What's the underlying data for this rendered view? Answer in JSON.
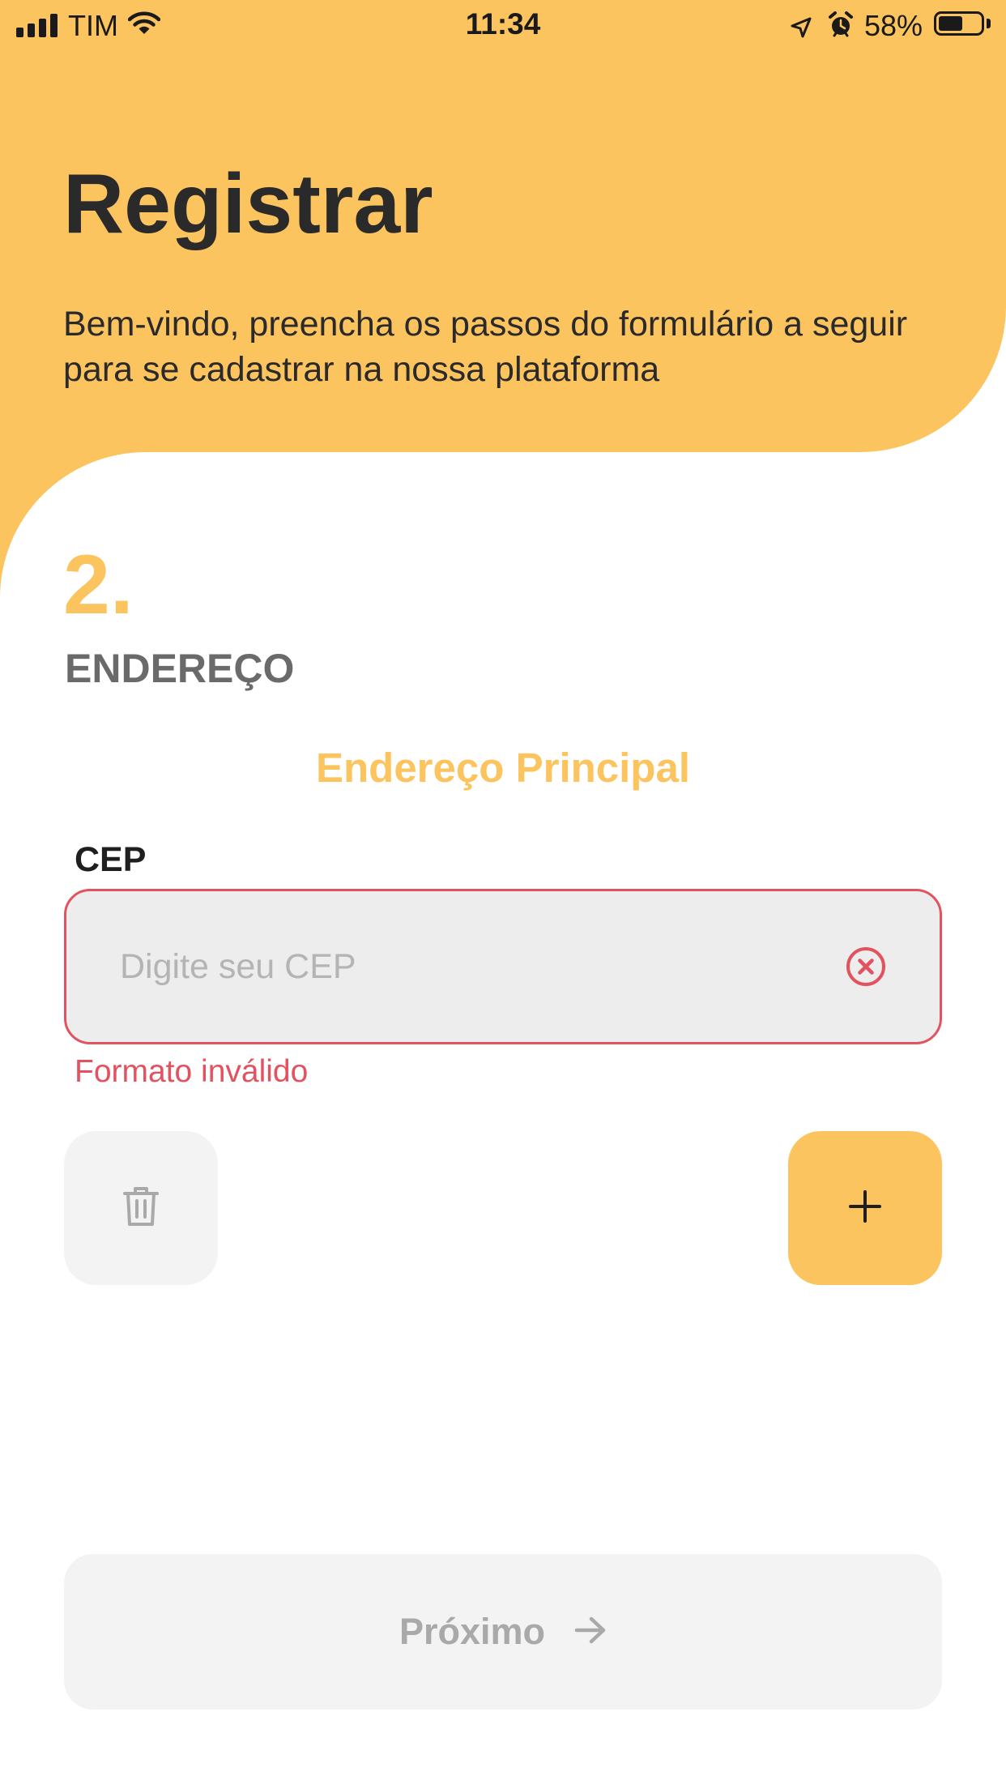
{
  "status_bar": {
    "carrier": "TIM",
    "time": "11:34",
    "battery_percent": "58%",
    "battery_level": 0.58,
    "icons": [
      "signal-icon",
      "wifi-icon",
      "location-icon",
      "alarm-icon",
      "battery-icon"
    ]
  },
  "header": {
    "title": "Registrar",
    "subtitle": "Bem-vindo, preencha os passos do formulário a seguir para se cadastrar na nossa plataforma"
  },
  "step": {
    "number": "2.",
    "title": "ENDEREÇO"
  },
  "section": {
    "title": "Endereço Principal"
  },
  "cep_field": {
    "label": "CEP",
    "value": "",
    "placeholder": "Digite seu CEP",
    "error": "Formato inválido",
    "clear_icon": "clear-circle-icon"
  },
  "actions": {
    "delete_icon": "trash-icon",
    "add_icon": "plus-icon"
  },
  "next_button": {
    "label": "Próximo",
    "icon": "arrow-right-icon",
    "enabled": false
  },
  "colors": {
    "accent": "#FCC45F",
    "error": "#E2525F",
    "text_dark": "#2a2a2a",
    "muted": "#a9a9a9",
    "input_bg": "#EDEDED",
    "button_disabled_bg": "#F3F3F3"
  }
}
